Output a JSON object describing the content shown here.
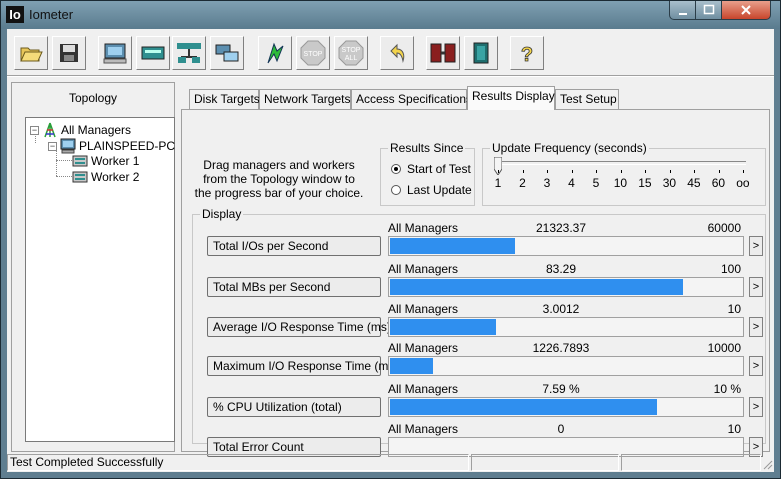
{
  "window": {
    "title": "Iometer",
    "app_icon": "Io"
  },
  "toolbar": {
    "buttons": [
      "open-config-icon",
      "save-config-icon",
      "new-disk-worker-icon",
      "new-network-worker-icon",
      "duplicate-worker-icon",
      "disconnect-manager-icon",
      "start-tests-icon",
      "stop-test-icon",
      "stop-all-icon",
      "reset-workers-icon",
      "exit-icon",
      "quit-icon",
      "about-icon"
    ],
    "labels": {
      "stop": "STOP",
      "stop_all_1": "STOP",
      "stop_all_2": "ALL",
      "help": "?"
    }
  },
  "topology": {
    "title": "Topology",
    "nodes": [
      {
        "label": "All Managers",
        "expander": "−"
      },
      {
        "label": "PLAINSPEED-PC",
        "expander": "−"
      },
      {
        "label": "Worker 1"
      },
      {
        "label": "Worker 2"
      }
    ]
  },
  "tabs": [
    {
      "label": "Disk Targets",
      "active": false
    },
    {
      "label": "Network Targets",
      "active": false
    },
    {
      "label": "Access Specifications",
      "active": false
    },
    {
      "label": "Results Display",
      "active": true
    },
    {
      "label": "Test Setup",
      "active": false
    }
  ],
  "results": {
    "drag_text": "Drag managers and workers from the Topology window to the progress bar of your choice.",
    "results_since": {
      "title": "Results Since",
      "options": [
        {
          "label": "Start of Test",
          "selected": true
        },
        {
          "label": "Last Update",
          "selected": false
        }
      ]
    },
    "update_frequency": {
      "title": "Update Frequency (seconds)",
      "ticks": [
        "1",
        "2",
        "3",
        "4",
        "5",
        "10",
        "15",
        "30",
        "45",
        "60",
        "oo"
      ],
      "selected_index": 0
    },
    "display_title": "Display",
    "more_label": ">",
    "rows": [
      {
        "metric": "Total I/Os per Second",
        "source": "All Managers",
        "value": "21323.37",
        "max": "60000",
        "fill": 0.355
      },
      {
        "metric": "Total MBs per Second",
        "source": "All Managers",
        "value": "83.29",
        "max": "100",
        "fill": 0.8329
      },
      {
        "metric": "Average I/O Response Time (ms)",
        "source": "All Managers",
        "value": "3.0012",
        "max": "10",
        "fill": 0.3
      },
      {
        "metric": "Maximum I/O Response Time (ms)",
        "source": "All Managers",
        "value": "1226.7893",
        "max": "10000",
        "fill": 0.1227
      },
      {
        "metric": "% CPU Utilization (total)",
        "source": "All Managers",
        "value": "7.59 %",
        "max": "10 %",
        "fill": 0.759
      },
      {
        "metric": "Total Error Count",
        "source": "All Managers",
        "value": "0",
        "max": "10",
        "fill": 0
      }
    ]
  },
  "statusbar": {
    "message": "Test Completed Successfully"
  },
  "colors": {
    "bar": "#2f8fef",
    "titlebar": "#6f8ea0",
    "close": "#c7452c"
  }
}
